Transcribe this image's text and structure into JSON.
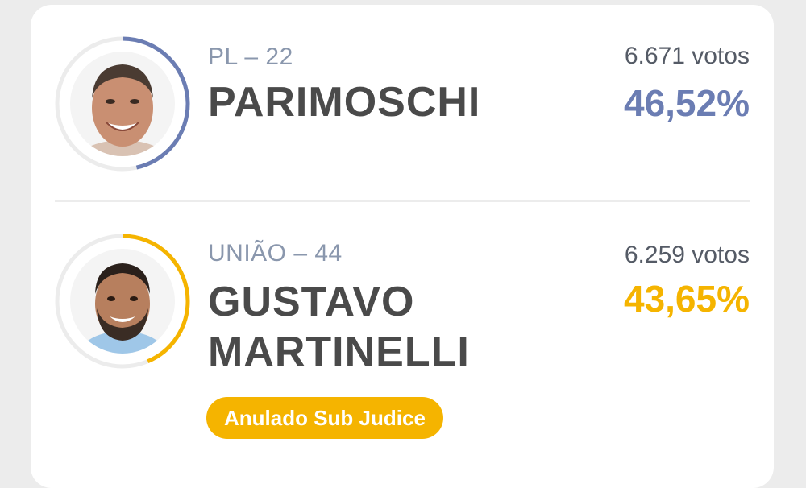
{
  "colors": {
    "pl_accent": "#6b7db3",
    "uniao_accent": "#f5b400",
    "name_text": "#4a4a4a",
    "party_text": "#8a97ad",
    "ring_track": "#ececec"
  },
  "candidates": [
    {
      "party": "PL – 22",
      "name": "PARIMOSCHI",
      "votes": "6.671 votos",
      "percent": "46,52%",
      "progress": 0.4652,
      "accent": "#6b7db3",
      "photo": "portrait-older-man-smiling"
    },
    {
      "party": "UNIÃO – 44",
      "name": "GUSTAVO MARTINELLI",
      "votes": "6.259 votos",
      "percent": "43,65%",
      "progress": 0.4365,
      "accent": "#f5b400",
      "photo": "portrait-bearded-young-man-smiling",
      "badge": "Anulado Sub Judice"
    }
  ]
}
